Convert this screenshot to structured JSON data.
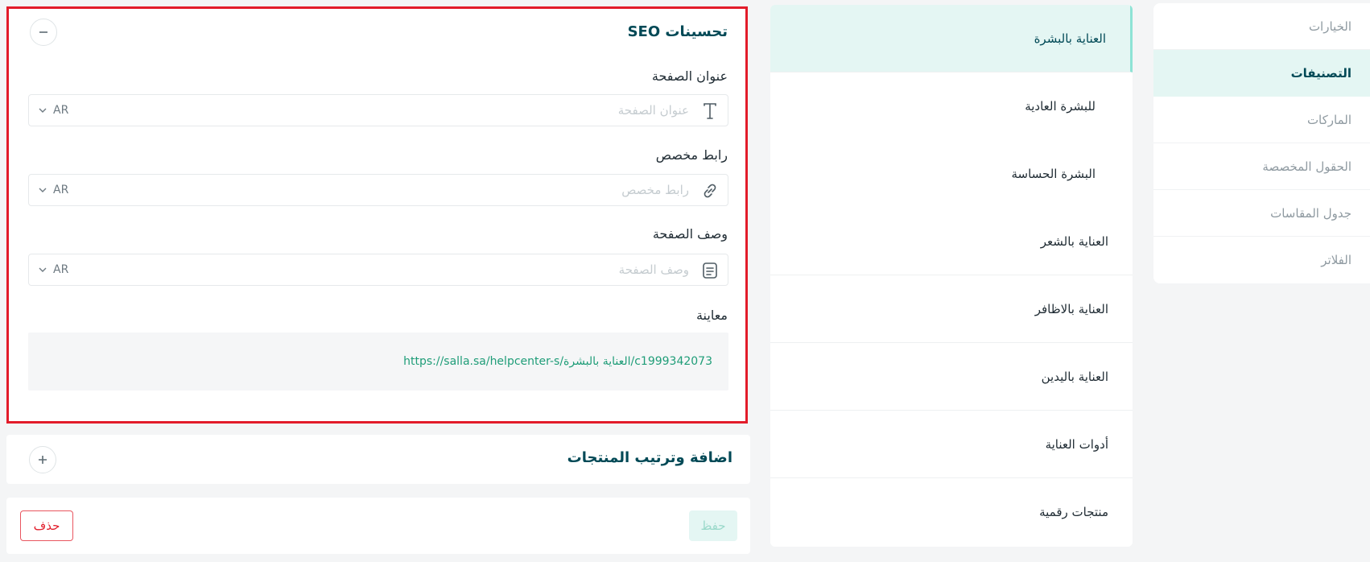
{
  "settings_nav": {
    "items": [
      {
        "label": "الخيارات"
      },
      {
        "label": "التصنيفات"
      },
      {
        "label": "الماركات"
      },
      {
        "label": "الحقول المخصصة"
      },
      {
        "label": "جدول المقاسات"
      },
      {
        "label": "الفلاتر"
      }
    ],
    "active_index": 1
  },
  "categories": {
    "items": [
      {
        "label": "العناية بالبشرة"
      },
      {
        "label": "للبشرة العادية"
      },
      {
        "label": "البشرة الحساسة"
      },
      {
        "label": "العناية بالشعر"
      },
      {
        "label": "العناية بالاظافر"
      },
      {
        "label": "العناية باليدين"
      },
      {
        "label": "أدوات العناية"
      },
      {
        "label": "منتجات رقمية"
      }
    ],
    "active_index": 0
  },
  "seo": {
    "title": "تحسينات SEO",
    "collapse_icon": "minus-icon",
    "fields": [
      {
        "label": "عنوان الصفحة",
        "placeholder": "عنوان الصفحة",
        "value": "",
        "icon": "text-icon",
        "lang": "AR"
      },
      {
        "label": "رابط مخصص",
        "placeholder": "رابط مخصص",
        "value": "",
        "icon": "link-icon",
        "lang": "AR"
      },
      {
        "label": "وصف الصفحة",
        "placeholder": "وصف الصفحة",
        "value": "",
        "icon": "document-icon",
        "lang": "AR"
      }
    ],
    "preview_label": "معاينة",
    "preview_url": "https://salla.sa/helpcenter-s/العناية بالبشرة/c1999342073"
  },
  "products_section": {
    "title": "اضافة وترتيب المنتجات",
    "expand_icon": "plus-icon"
  },
  "actions": {
    "save_label": "حفظ",
    "delete_label": "حذف"
  },
  "colors": {
    "accent": "#004956",
    "accent_light": "#e4f6f3",
    "highlight_border": "#e21c2a",
    "link_green": "#1f9d78"
  }
}
